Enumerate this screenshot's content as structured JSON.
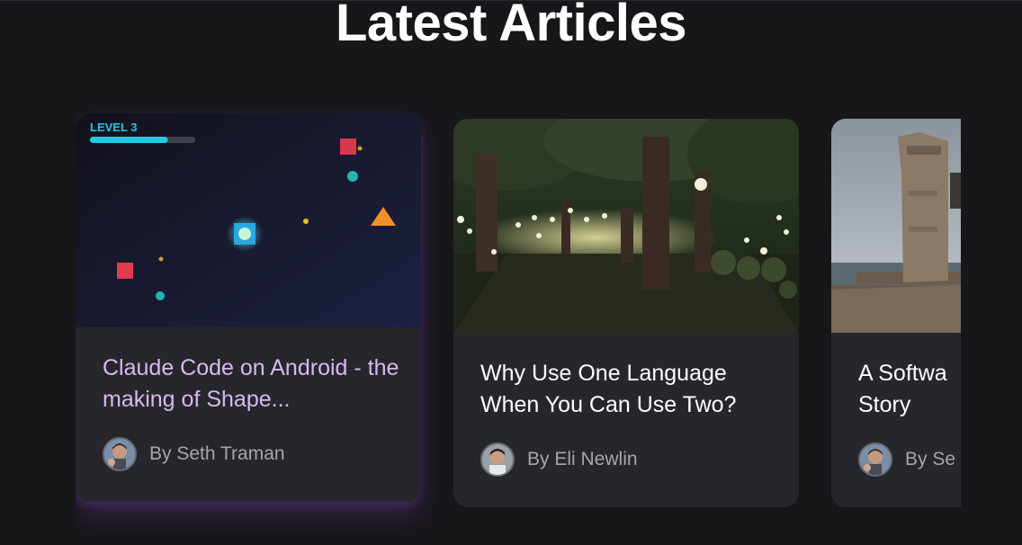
{
  "page": {
    "title": "Latest Articles"
  },
  "articles": [
    {
      "title": "Claude Code on Android - the making of Shape...",
      "author": "By Seth Traman",
      "thumbnail": "game-screenshot",
      "game_hud": {
        "level_label": "LEVEL 3",
        "progress": 0.74
      },
      "highlighted": true
    },
    {
      "title": "Why Use One Language When You Can Use Two?",
      "author": "By Eli Newlin",
      "thumbnail": "forest-scene"
    },
    {
      "title": "A Softwa Story",
      "author": "By Se",
      "thumbnail": "stone-tower-photo"
    }
  ],
  "colors": {
    "background": "#17171a",
    "card": "#26272c",
    "highlight_title": "#d8b8f0",
    "highlight_glow": "#8c46c8",
    "hud_progress": "#22c8e8"
  }
}
